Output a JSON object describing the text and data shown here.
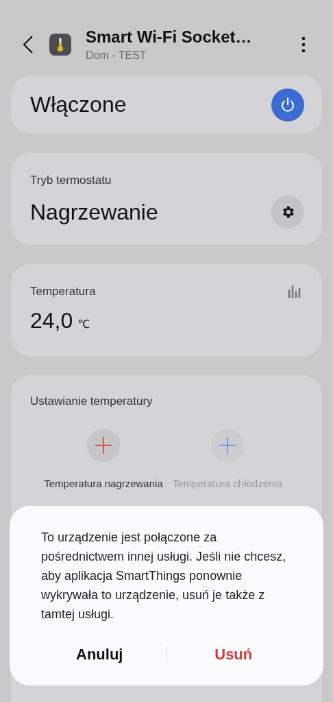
{
  "header": {
    "title": "Smart Wi-Fi Socket…",
    "subtitle": "Dom - TEST"
  },
  "power_card": {
    "label": "Włączone",
    "on": true
  },
  "mode_card": {
    "label": "Tryb termostatu",
    "value": "Nagrzewanie"
  },
  "temperature_card": {
    "label": "Temperatura",
    "value": "24,0",
    "unit": "℃"
  },
  "setpoint_card": {
    "title": "Ustawianie temperatury",
    "setpoints": [
      {
        "label": "Temperatura nagrzewania",
        "color": "#d9563a",
        "disabled": false
      },
      {
        "label": "Temperatura chłodzenia",
        "color": "#6b9ee0",
        "disabled": true
      }
    ]
  },
  "dialog": {
    "message": "To urządzenie jest połączone za pośrednictwem innej usługi. Jeśli nie chcesz, aby aplikacja SmartThings ponownie wykrywała to urządzenie, usuń je także z tamtej usługi.",
    "buttons": [
      {
        "label": "Anuluj",
        "kind": "cancel"
      },
      {
        "label": "Usuń",
        "kind": "destructive"
      }
    ]
  }
}
